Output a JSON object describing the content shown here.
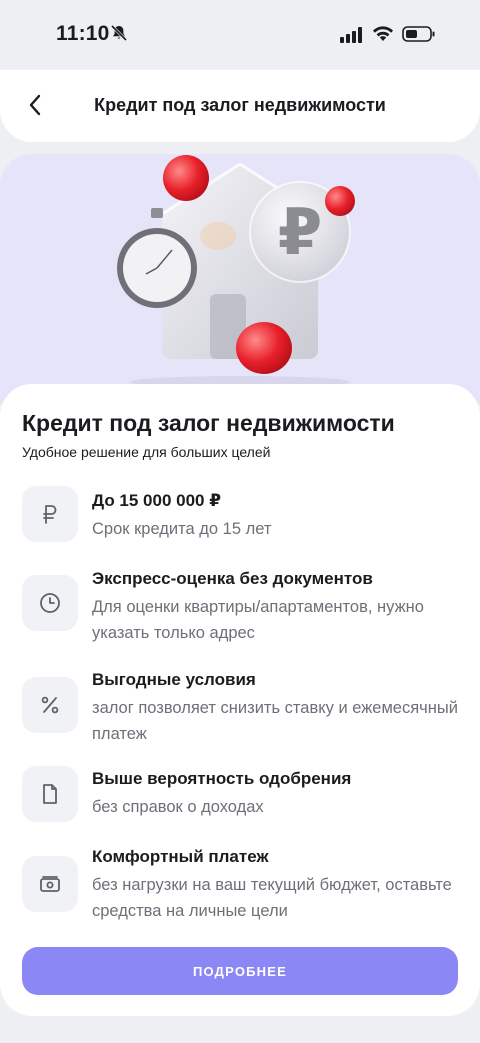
{
  "status_bar": {
    "time": "11:10",
    "icons": [
      "bell-slash-icon",
      "cellular-signal-icon",
      "wifi-icon",
      "battery-icon"
    ]
  },
  "header": {
    "title": "Кредит под залог недвижимости",
    "back_icon": "chevron-left-icon"
  },
  "hero": {
    "background_color": "#e6e4f8",
    "illustration": "house-stopwatch-ruble-illustration"
  },
  "card": {
    "title": "Кредит под залог недвижимости",
    "subtitle": "Удобное решение для больших целей",
    "features": [
      {
        "icon": "ruble-icon",
        "title": "До 15 000 000 ₽",
        "description": "Срок кредита до 15 лет"
      },
      {
        "icon": "clock-icon",
        "title": "Экспресс-оценка без документов",
        "description": "Для оценки квартиры/апартаментов, нужно указать только адрес"
      },
      {
        "icon": "percent-icon",
        "title": "Выгодные условия",
        "description": "залог позволяет снизить ставку и ежемесячный платеж"
      },
      {
        "icon": "document-icon",
        "title": "Выше вероятность одобрения",
        "description": "без справок о доходах"
      },
      {
        "icon": "cash-icon",
        "title": "Комфортный платеж",
        "description": "без нагрузки на ваш текущий бюджет, оставьте средства на личные цели"
      }
    ],
    "cta_label": "ПОДРОБНЕЕ"
  },
  "colors": {
    "accent": "#8b87f5",
    "hero_bg": "#e6e4f8",
    "page_bg": "#eeeff3",
    "secondary_text": "#6d7078"
  }
}
